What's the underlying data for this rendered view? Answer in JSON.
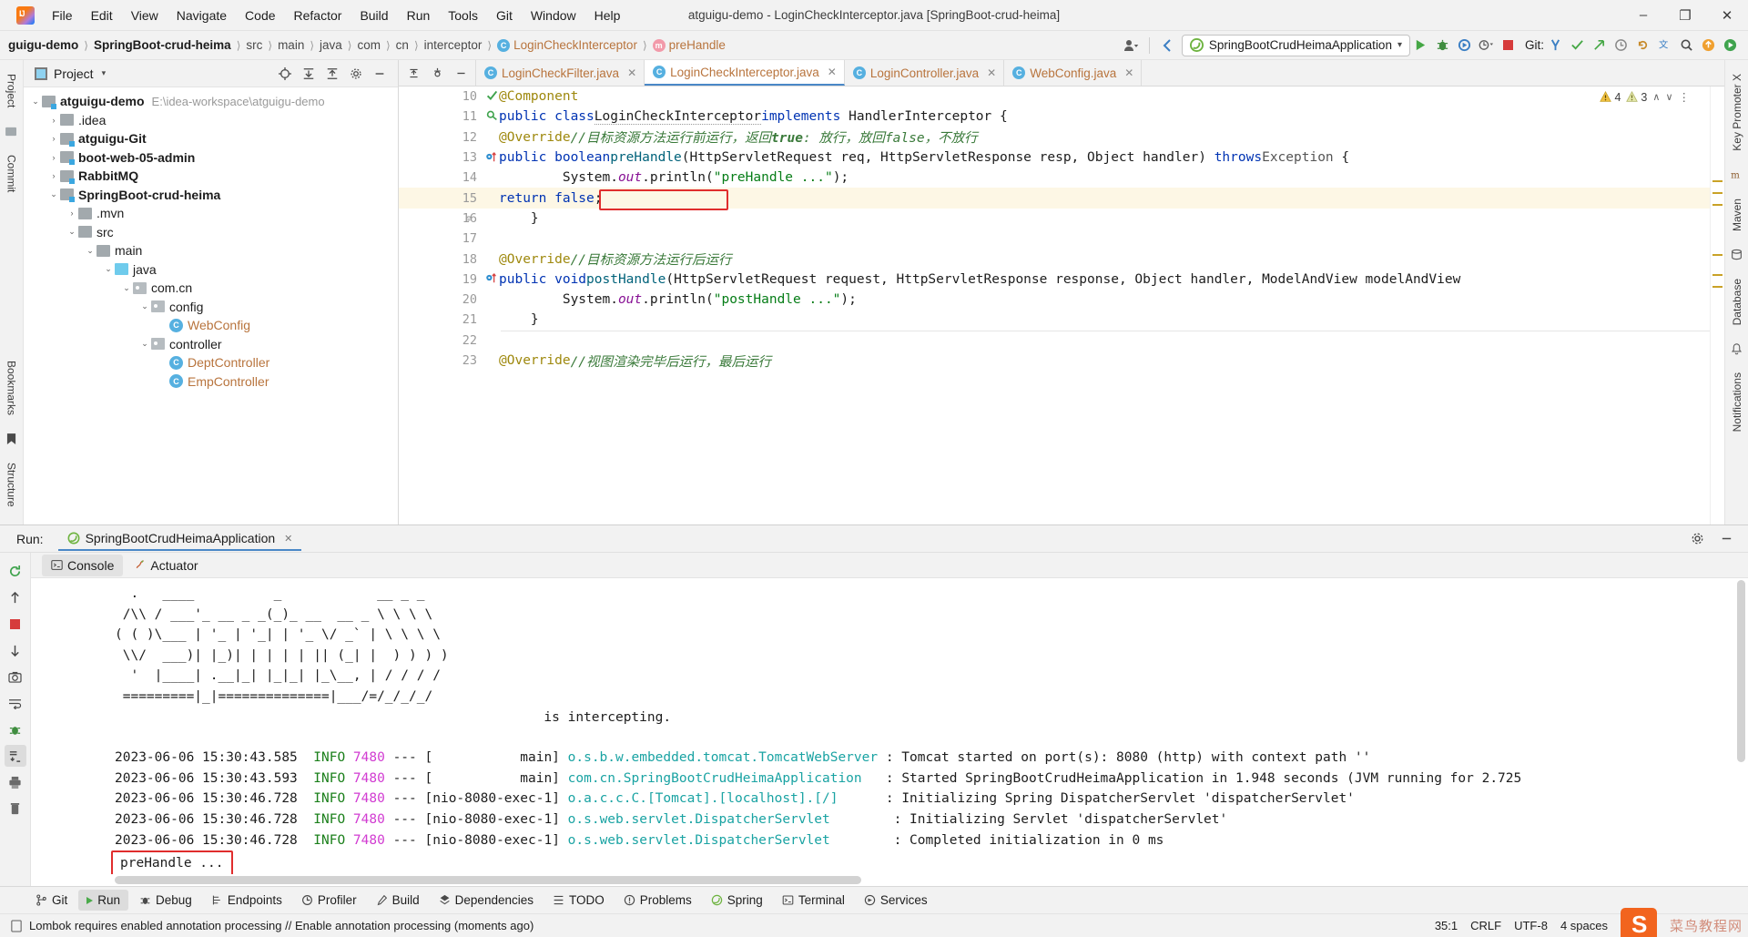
{
  "window": {
    "title": "atguigu-demo - LoginCheckInterceptor.java [SpringBoot-crud-heima]",
    "minimize": "–",
    "maximize": "❐",
    "close": "✕"
  },
  "menubar": [
    {
      "label": "File"
    },
    {
      "label": "Edit"
    },
    {
      "label": "View"
    },
    {
      "label": "Navigate"
    },
    {
      "label": "Code"
    },
    {
      "label": "Refactor"
    },
    {
      "label": "Build"
    },
    {
      "label": "Run"
    },
    {
      "label": "Tools"
    },
    {
      "label": "Git"
    },
    {
      "label": "Window"
    },
    {
      "label": "Help"
    }
  ],
  "breadcrumb": [
    {
      "label": "guigu-demo",
      "style": "bold"
    },
    {
      "label": "SpringBoot-crud-heima",
      "style": "bold"
    },
    {
      "label": "src",
      "style": "grey"
    },
    {
      "label": "main",
      "style": "grey"
    },
    {
      "label": "java",
      "style": "grey"
    },
    {
      "label": "com",
      "style": "grey"
    },
    {
      "label": "cn",
      "style": "grey"
    },
    {
      "label": "interceptor",
      "style": "grey"
    },
    {
      "label": "LoginCheckInterceptor",
      "style": "cls",
      "badge": "C"
    },
    {
      "label": "preHandle",
      "style": "mth",
      "badge": "m"
    }
  ],
  "toolbar": {
    "run_config": "SpringBootCrudHeimaApplication",
    "run_config_caret": "▾",
    "git_label": "Git:",
    "icons": [
      "profile-dropdown-icon",
      "back-icon",
      "run-icon",
      "debug-icon",
      "run-with-coverage-icon",
      "profiler-icon",
      "stop-icon",
      "git-update-icon",
      "git-commit-icon",
      "git-push-icon",
      "git-history-icon",
      "git-rollback-icon",
      "translate-icon",
      "search-icon",
      "upload-icon",
      "play-icon"
    ]
  },
  "left_rail": [
    "Project",
    "Commit"
  ],
  "right_rail": [
    "Key Promoter X",
    "Maven",
    "Database",
    "Notifications"
  ],
  "bottom_left_rail": [
    "Bookmarks",
    "Structure"
  ],
  "project_panel": {
    "title": "Project",
    "caret": "▾",
    "header_icons": [
      "locate-icon",
      "expand-all-icon",
      "collapse-all-icon",
      "settings-icon",
      "hide-icon"
    ],
    "tree": [
      {
        "depth": 0,
        "arrow": "⌄",
        "icon": "mod",
        "label": "atguigu-demo",
        "bold": true,
        "path": "E:\\idea-workspace\\atguigu-demo"
      },
      {
        "depth": 1,
        "arrow": "›",
        "icon": "plain",
        "label": ".idea",
        "bold": false
      },
      {
        "depth": 1,
        "arrow": "›",
        "icon": "mod",
        "label": "atguigu-Git",
        "bold": true
      },
      {
        "depth": 1,
        "arrow": "›",
        "icon": "mod",
        "label": "boot-web-05-admin",
        "bold": true
      },
      {
        "depth": 1,
        "arrow": "›",
        "icon": "mod",
        "label": "RabbitMQ",
        "bold": true
      },
      {
        "depth": 1,
        "arrow": "⌄",
        "icon": "mod",
        "label": "SpringBoot-crud-heima",
        "bold": true
      },
      {
        "depth": 2,
        "arrow": "›",
        "icon": "plain",
        "label": ".mvn",
        "bold": false
      },
      {
        "depth": 2,
        "arrow": "⌄",
        "icon": "plain",
        "label": "src",
        "bold": false
      },
      {
        "depth": 3,
        "arrow": "⌄",
        "icon": "plain",
        "label": "main",
        "bold": false
      },
      {
        "depth": 4,
        "arrow": "⌄",
        "icon": "src",
        "label": "java",
        "bold": false
      },
      {
        "depth": 5,
        "arrow": "⌄",
        "icon": "pkg",
        "label": "com.cn",
        "bold": false
      },
      {
        "depth": 6,
        "arrow": "⌄",
        "icon": "pkg",
        "label": "config",
        "bold": false
      },
      {
        "depth": 7,
        "arrow": "",
        "icon": "class",
        "label": "WebConfig",
        "bold": false
      },
      {
        "depth": 6,
        "arrow": "⌄",
        "icon": "pkg",
        "label": "controller",
        "bold": false
      },
      {
        "depth": 7,
        "arrow": "",
        "icon": "class",
        "label": "DeptController",
        "bold": false
      },
      {
        "depth": 7,
        "arrow": "",
        "icon": "class",
        "label": "EmpController",
        "bold": false
      }
    ]
  },
  "editor": {
    "tab_tools": [
      "collapse-icon",
      "settings-icon",
      "hide-icon"
    ],
    "tabs": [
      {
        "label": "LoginCheckFilter.java",
        "active": false,
        "badge": "C"
      },
      {
        "label": "LoginCheckInterceptor.java",
        "active": true,
        "badge": "C"
      },
      {
        "label": "LoginController.java",
        "active": false,
        "badge": "C"
      },
      {
        "label": "WebConfig.java",
        "active": false,
        "badge": "C"
      }
    ],
    "inspection": {
      "warnings": "4",
      "weak_warnings": "3",
      "caret_up": "∧",
      "caret_down": "∨",
      "more": "⋮"
    },
    "lines": [
      {
        "num": "10",
        "marker": "impl-check-icon",
        "text": "@Component"
      },
      {
        "num": "11",
        "marker": "class-impl-icon",
        "text": "public class LoginCheckInterceptor implements HandlerInterceptor {"
      },
      {
        "num": "12",
        "marker": "",
        "text": "    @Override //目标资源方法运行前运行，返回true: 放行，放回false，不放行"
      },
      {
        "num": "13",
        "marker": "override-icon",
        "text": "    public boolean preHandle(HttpServletRequest req, HttpServletResponse resp, Object handler) throws Exception {"
      },
      {
        "num": "14",
        "marker": "",
        "text": "        System.out.println(\"preHandle ...\");"
      },
      {
        "num": "15",
        "marker": "",
        "text": "        return false;",
        "highlighted": true,
        "boxed": true
      },
      {
        "num": "16",
        "marker": "",
        "text": "    }"
      },
      {
        "num": "17",
        "marker": "",
        "text": ""
      },
      {
        "num": "18",
        "marker": "",
        "text": "    @Override //目标资源方法运行后运行"
      },
      {
        "num": "19",
        "marker": "override-icon",
        "text": "    public void postHandle(HttpServletRequest request, HttpServletResponse response, Object handler, ModelAndView modelAndView"
      },
      {
        "num": "20",
        "marker": "",
        "text": "        System.out.println(\"postHandle ...\");"
      },
      {
        "num": "21",
        "marker": "",
        "text": "    }"
      },
      {
        "num": "22",
        "marker": "",
        "text": ""
      },
      {
        "num": "23",
        "marker": "",
        "text": "    @Override //视图渲染完毕后运行，最后运行"
      }
    ]
  },
  "run_window": {
    "label": "Run:",
    "tab_title": "SpringBootCrudHeimaApplication",
    "tab_close": "✕",
    "header_icons": [
      "settings-icon",
      "minimize-icon"
    ],
    "rail_icons": [
      "rerun-icon",
      "scroll-up-icon",
      "stop-icon",
      "scroll-down-icon",
      "camera-icon",
      "soft-wrap-icon",
      "bug-icon",
      "scroll-to-end-icon",
      "print-icon",
      "clear-all-icon"
    ],
    "console_tabs": [
      {
        "label": "Console",
        "active": true,
        "icon": "console-icon"
      },
      {
        "label": "Actuator",
        "active": false,
        "icon": "actuator-icon"
      }
    ],
    "banner": [
      "  .   ____          _            __ _ _",
      " /\\\\ / ___'_ __ _ _(_)_ __  __ _ \\ \\ \\ \\",
      "( ( )\\___ | '_ | '_| | '_ \\/ _` | \\ \\ \\ \\",
      " \\\\/  ___)| |_)| | | | | || (_| |  ) ) ) )",
      "  '  |____| .__|_| |_|_| |_\\__, | / / / /",
      " =========|_|==============|___/=/_/_/_/",
      "                                                      is intercepting."
    ],
    "logs": [
      {
        "ts": "2023-06-06 15:30:43.585",
        "level": "INFO",
        "pid": "7480",
        "thread": "main",
        "logger": "o.s.b.w.embedded.tomcat.TomcatWebServer",
        "msg": ": Tomcat started on port(s): 8080 (http) with context path ''"
      },
      {
        "ts": "2023-06-06 15:30:43.593",
        "level": "INFO",
        "pid": "7480",
        "thread": "main",
        "logger": "com.cn.SpringBootCrudHeimaApplication",
        "msg": ": Started SpringBootCrudHeimaApplication in 1.948 seconds (JVM running for 2.725"
      },
      {
        "ts": "2023-06-06 15:30:46.728",
        "level": "INFO",
        "pid": "7480",
        "thread": "nio-8080-exec-1",
        "logger": "o.a.c.c.C.[Tomcat].[localhost].[/]",
        "msg": ": Initializing Spring DispatcherServlet 'dispatcherServlet'"
      },
      {
        "ts": "2023-06-06 15:30:46.728",
        "level": "INFO",
        "pid": "7480",
        "thread": "nio-8080-exec-1",
        "logger": "o.s.web.servlet.DispatcherServlet",
        "msg": ": Initializing Servlet 'dispatcherServlet'"
      },
      {
        "ts": "2023-06-06 15:30:46.728",
        "level": "INFO",
        "pid": "7480",
        "thread": "nio-8080-exec-1",
        "logger": "o.s.web.servlet.DispatcherServlet",
        "msg": ": Completed initialization in 0 ms"
      }
    ],
    "highlighted_output": "preHandle ..."
  },
  "bottom_toolstrip": [
    {
      "label": "Git",
      "icon": "git-branch-icon",
      "active": false
    },
    {
      "label": "Run",
      "icon": "run-icon",
      "active": true
    },
    {
      "label": "Debug",
      "icon": "debug-icon",
      "active": false
    },
    {
      "label": "Endpoints",
      "icon": "endpoints-icon",
      "active": false
    },
    {
      "label": "Profiler",
      "icon": "profiler-icon",
      "active": false
    },
    {
      "label": "Build",
      "icon": "build-icon",
      "active": false
    },
    {
      "label": "Dependencies",
      "icon": "dependencies-icon",
      "active": false
    },
    {
      "label": "TODO",
      "icon": "todo-icon",
      "active": false
    },
    {
      "label": "Problems",
      "icon": "problems-icon",
      "active": false
    },
    {
      "label": "Spring",
      "icon": "spring-icon",
      "active": false
    },
    {
      "label": "Terminal",
      "icon": "terminal-icon",
      "active": false
    },
    {
      "label": "Services",
      "icon": "services-icon",
      "active": false
    }
  ],
  "statusbar": {
    "message": "Lombok requires enabled annotation processing // Enable annotation processing (moments ago)",
    "caret_position": "35:1",
    "line_separator": "CRLF",
    "encoding": "UTF-8",
    "indent": "4 spaces",
    "watermark": "菜鸟教程网"
  },
  "colors": {
    "accent": "#4a88c7",
    "highlight_box": "#e02d2d",
    "keyword": "#0033b3",
    "string": "#067d17",
    "comment": "#3a7a3a",
    "annotation": "#9e880d",
    "logger": "#1aa3a3",
    "info_level": "#1a7f1a",
    "pid": "#d13bd1",
    "line_highlight": "#fdf7e5"
  }
}
